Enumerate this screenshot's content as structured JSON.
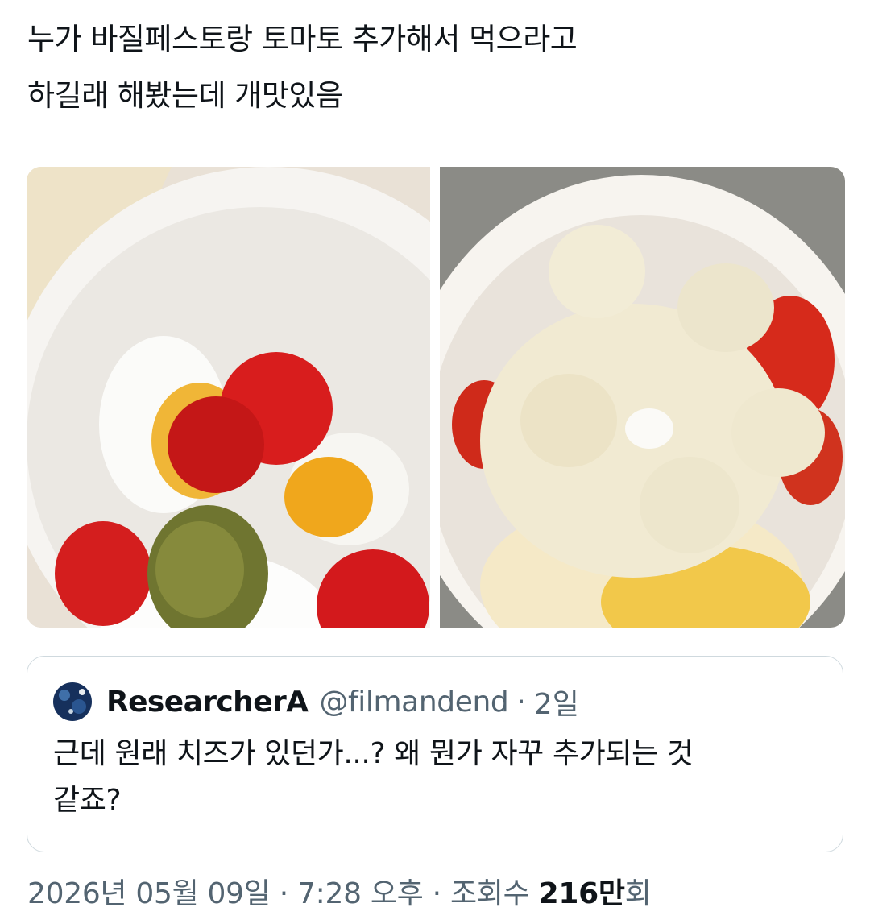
{
  "post": {
    "text_line1": "누가 바질페스토랑 토마토 추가해서 먹으라고",
    "text_line2": "하길래 해봤는데 개맛있음"
  },
  "media": {
    "left_image": "boiled eggs with cherry tomatoes and basil pesto in a white bowl",
    "right_image": "boiled eggs topped with mayonnaise and black pepper in a white bowl"
  },
  "quote": {
    "name": "ResearcherA",
    "handle": "@filmandend",
    "separator": "·",
    "time": "2일",
    "text_line1": "근데 원래 치즈가 있던가...? 왜 뭔가 자꾸 추가되는 것",
    "text_line2": "같죠?"
  },
  "meta": {
    "date": "2026년 05월 09일",
    "sep1": "·",
    "time": "7:28 오후",
    "sep2": "·",
    "views_label": "조회수",
    "views_count": "216만",
    "views_suffix": "회"
  },
  "colors": {
    "text": "#0f1419",
    "secondary": "#536471",
    "border": "#cfd9de"
  }
}
